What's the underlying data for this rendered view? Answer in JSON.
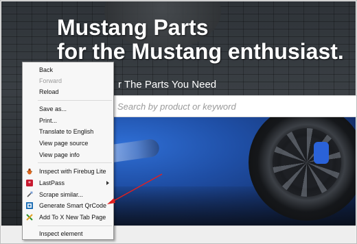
{
  "hero": {
    "title_line1": "Mustang Parts",
    "title_line2": "for the Mustang enthusiast.",
    "subtitle": "r The Parts You Need",
    "search_placeholder": "Search by product or keyword"
  },
  "context_menu": {
    "items": [
      {
        "label": "Back",
        "enabled": true
      },
      {
        "label": "Forward",
        "enabled": false
      },
      {
        "label": "Reload",
        "enabled": true
      },
      {
        "label": "Save as...",
        "enabled": true
      },
      {
        "label": "Print...",
        "enabled": true
      },
      {
        "label": "Translate to English",
        "enabled": true
      },
      {
        "label": "View page source",
        "enabled": true
      },
      {
        "label": "View page info",
        "enabled": true
      },
      {
        "label": "Inspect with Firebug Lite",
        "icon": "firebug-icon",
        "enabled": true
      },
      {
        "label": "LastPass",
        "icon": "lastpass-icon",
        "has_submenu": true,
        "enabled": true
      },
      {
        "label": "Scrape similar...",
        "icon": "scraper-icon",
        "enabled": true
      },
      {
        "label": "Generate Smart QrCode",
        "icon": "qrcode-icon",
        "enabled": true
      },
      {
        "label": "Add To X New Tab Page",
        "icon": "xnewtab-icon",
        "enabled": true
      },
      {
        "label": "Inspect element",
        "enabled": true
      }
    ]
  },
  "annotation": {
    "color": "#e02020",
    "target": "Generate Smart QrCode"
  }
}
